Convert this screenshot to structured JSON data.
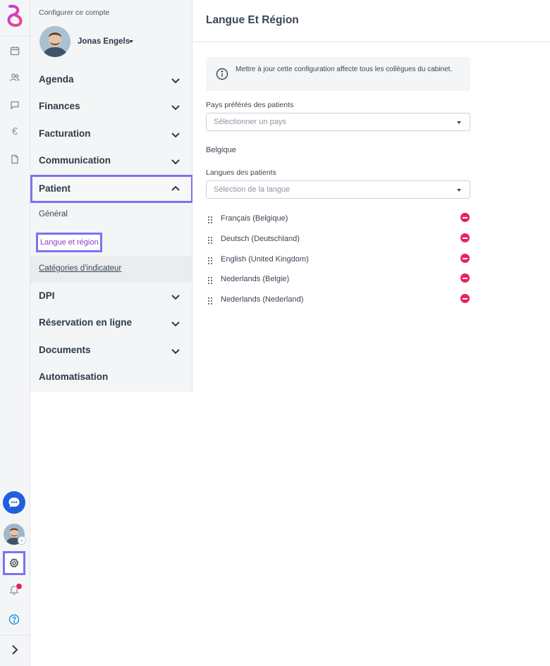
{
  "nav": {
    "account_title": "Configurer ce compte",
    "user_name": "Jonas Engels",
    "sections": {
      "agenda": "Agenda",
      "finances": "Finances",
      "facturation": "Facturation",
      "communication": "Communication",
      "patient": "Patient",
      "dpi": "DPI",
      "reservation": "Réservation en ligne",
      "documents": "Documents",
      "automatisation": "Automatisation"
    },
    "patient_items": {
      "general": "Général",
      "langue": "Langue et région",
      "categories": "Catégories d'indicateur"
    }
  },
  "main": {
    "title": "Langue Et Région",
    "info": "Mettre à jour cette configuration affecte tous les collègues du cabinet.",
    "countries_label": "Pays préférés des patients",
    "countries_placeholder": "Sélectionner un pays",
    "selected_country": "Belgique",
    "languages_label": "Langues des patients",
    "languages_placeholder": "Sélection de la langue",
    "languages": [
      "Français (Belgique)",
      "Deutsch (Deutschland)",
      "English (United Kingdom)",
      "Nederlands (Belgie)",
      "Nederlands (Nederland)"
    ]
  },
  "colors": {
    "accent": "#7b73f2",
    "active_link": "#8a3fc7",
    "remove": "#e8245a",
    "chat": "#1f5fe0"
  },
  "icons": {
    "rail": [
      "calendar-icon",
      "users-icon",
      "message-icon",
      "euro-icon",
      "document-icon",
      "chat-icon",
      "gear-icon",
      "bell-icon",
      "help-icon",
      "chevron-right-icon"
    ],
    "main": [
      "info-icon",
      "drag-handle-icon",
      "remove-icon"
    ]
  }
}
